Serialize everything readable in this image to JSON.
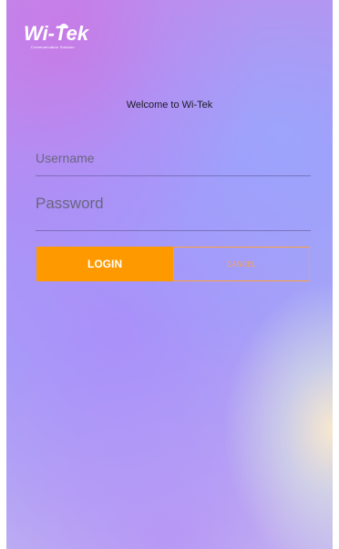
{
  "brand": {
    "logo_text": "Wi-Tek",
    "tagline": "Communication Solution",
    "logo_icon": "wifi-signal-icon"
  },
  "login": {
    "welcome": "Welcome to Wi-Tek",
    "username_placeholder": "Username",
    "password_placeholder": "Password",
    "login_label": "LOGIN",
    "cancel_label": "CANCEL"
  },
  "colors": {
    "accent": "#fe9a00",
    "cancel_text": "#f6a35a",
    "welcome_text": "#1c1c28"
  }
}
